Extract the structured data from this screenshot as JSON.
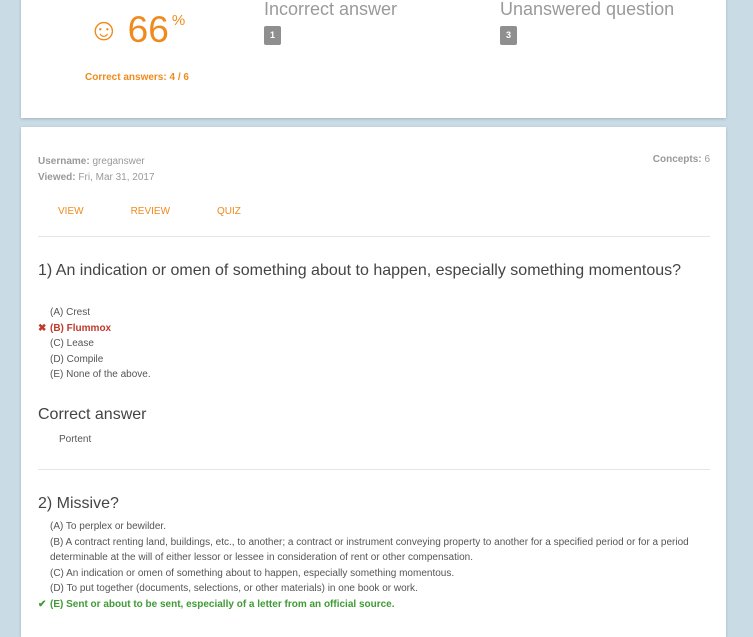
{
  "summary": {
    "smiley": "☺",
    "percent": "66",
    "percent_sign": "%",
    "correct_label": "Correct answers: 4 / 6",
    "incorrect_title": "Incorrect answer",
    "incorrect_count": "1",
    "unanswered_title": "Unanswered question",
    "unanswered_count": "3"
  },
  "details": {
    "username_label": "Username:",
    "username": "greganswer",
    "viewed_label": "Viewed:",
    "viewed": "Fri, Mar 31, 2017",
    "concepts_label": "Concepts:",
    "concepts": "6",
    "tabs": [
      "VIEW",
      "REVIEW",
      "QUIZ"
    ]
  },
  "questions": [
    {
      "title": "1) An indication or omen of something about to happen, especially something momentous?",
      "options": [
        "(A) Crest",
        "(B) Flummox",
        "(C) Lease",
        "(D) Compile",
        "(E) None of the above."
      ],
      "correct_heading": "Correct answer",
      "correct_answer": "Portent"
    },
    {
      "title": "2) Missive?",
      "options": [
        "(A) To perplex or bewilder.",
        "(B) A contract renting land, buildings, etc., to another; a contract or instrument conveying property to another for a specified period or for a period determinable at the will of either lessor or lessee in consideration of rent or other compensation.",
        "(C) An indication or omen of something about to happen, especially something momentous.",
        "(D) To put together (documents, selections, or other materials) in one book or work.",
        "(E) Sent or about to be sent, especially of a letter from an official source."
      ]
    }
  ],
  "marks": {
    "wrong": "✖",
    "right": "✔"
  },
  "colors": {
    "accent": "#f08a1c",
    "wrong": "#c0392b",
    "right": "#3f9b35",
    "background": "#c9dce6"
  }
}
